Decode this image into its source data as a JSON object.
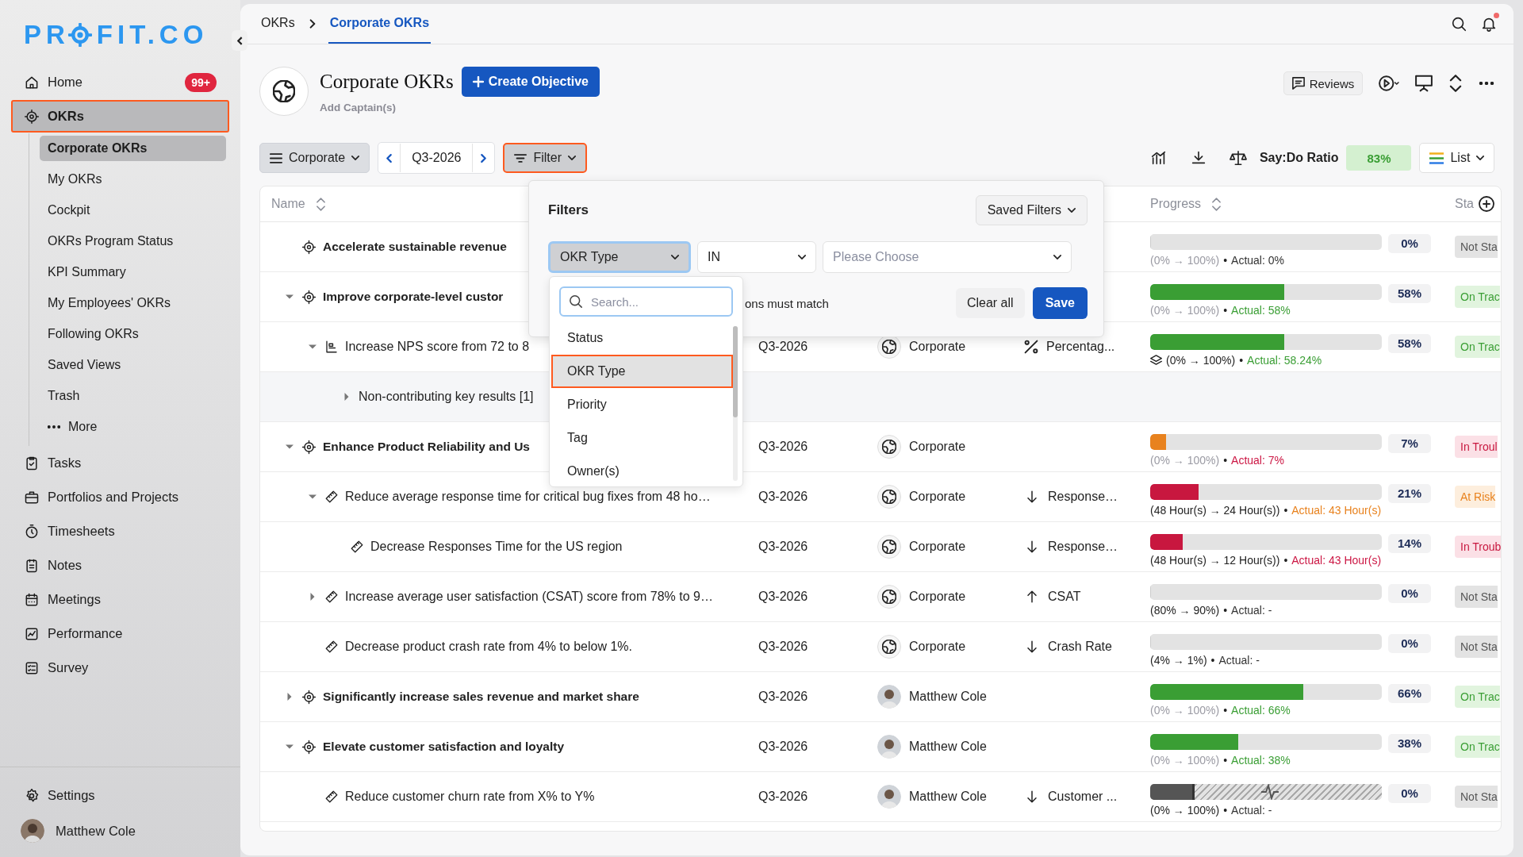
{
  "sidebar": {
    "logo": {
      "before": "PR",
      "after": "FIT.CO"
    },
    "items": [
      {
        "label": "Home",
        "badge": "99+",
        "selected": false,
        "highlighted": false
      },
      {
        "label": "OKRs",
        "selected": true,
        "highlighted": true,
        "expanded": true,
        "children": [
          {
            "label": "Corporate OKRs",
            "selected": true
          },
          {
            "label": "My OKRs",
            "selected": false
          },
          {
            "label": "Cockpit",
            "selected": false
          },
          {
            "label": "OKRs Program Status",
            "selected": false
          },
          {
            "label": "KPI Summary",
            "selected": false
          },
          {
            "label": "My Employees' OKRs",
            "selected": false
          },
          {
            "label": "Following OKRs",
            "selected": false
          },
          {
            "label": "Saved Views",
            "selected": false
          },
          {
            "label": "Trash",
            "selected": false
          },
          {
            "label": "More",
            "selected": false,
            "kind": "more"
          }
        ]
      },
      {
        "label": "Tasks",
        "selected": false,
        "highlighted": false
      },
      {
        "label": "Portfolios and Projects",
        "selected": false,
        "highlighted": false
      },
      {
        "label": "Timesheets",
        "selected": false,
        "highlighted": false
      },
      {
        "label": "Notes",
        "selected": false,
        "highlighted": false
      },
      {
        "label": "Meetings",
        "selected": false,
        "highlighted": false
      },
      {
        "label": "Performance",
        "selected": false,
        "highlighted": false
      },
      {
        "label": "Survey",
        "selected": false,
        "highlighted": false
      }
    ],
    "settings": "Settings",
    "user": "Matthew Cole"
  },
  "breadcrumb": [
    {
      "label": "OKRs",
      "selected": false
    },
    {
      "label": "Corporate OKRs",
      "selected": true
    }
  ],
  "header": {
    "title": "Corporate OKRs",
    "create_button": "Create Objective",
    "captains_link": "Add Captain(s)",
    "reviews_button": "Reviews"
  },
  "toolbar": {
    "view": "Corporate",
    "period": "Q3-2026",
    "filter_button": {
      "label": "Filter",
      "highlighted": true
    },
    "say_do_label": "Say:Do Ratio",
    "say_do_value": "83%",
    "layout": "List"
  },
  "table": {
    "columns": [
      {
        "label": "Name"
      },
      {
        "label": "Progress"
      },
      {
        "label": "Sta"
      }
    ],
    "rows": [
      {
        "kind": "objective",
        "name": "Accelerate sustainable revenue",
        "progress": {
          "kind": "plain",
          "level": 0,
          "percent": "0%",
          "range": "(0% → 100%)",
          "bullet": "•",
          "actual": "Actual: 0%"
        },
        "status": {
          "kind": "not_started",
          "label": "Not Sta"
        }
      },
      {
        "kind": "objective",
        "name": "Improve corporate-level custor",
        "expanded": true,
        "progress": {
          "kind": "plain",
          "level": 0.58,
          "color": "#3a9e34",
          "percent": "58%",
          "range": "(0% → 100%)",
          "bullet": "•",
          "actual": "Actual: 58%"
        },
        "status": {
          "kind": "on_track",
          "label": "On Trac"
        },
        "children": [
          {
            "kind": "kpi",
            "name": "Increase NPS score from 72 to 8",
            "expanded": true,
            "period": "Q3-2026",
            "owner": {
              "kind": "team",
              "name": "Corporate"
            },
            "metric": {
              "kind": "percent",
              "label": "Percentag..."
            },
            "progress": {
              "kind": "plain",
              "level": 0.58,
              "color": "#3a9e34",
              "percent": "58%",
              "range": "(0% → 100%)",
              "bullet": "•",
              "actual": "Actual: 58.24%"
            },
            "status": {
              "kind": "on_track",
              "label": "On Trac"
            },
            "children": [
              {
                "kind": "group",
                "name": "Non-contributing key results [1]",
                "expanded": false
              }
            ]
          }
        ]
      },
      {
        "kind": "objective",
        "name": "Enhance Product Reliability and Us",
        "expanded": true,
        "period": "Q3-2026",
        "owner": {
          "kind": "team",
          "name": "Corporate"
        },
        "progress": {
          "kind": "plain",
          "level": 0.07,
          "color": "#e8821e",
          "percent": "7%",
          "range": "(0% → 100%)",
          "bullet": "•",
          "actual": "Actual: 7%"
        },
        "status": {
          "kind": "in_trouble",
          "label": "In Troul"
        },
        "children": [
          {
            "kind": "key_result",
            "name": "Reduce average response time for critical bug fixes from 48 ho…",
            "expanded": true,
            "period": "Q3-2026",
            "owner": {
              "kind": "team",
              "name": "Corporate"
            },
            "metric": {
              "kind": "down",
              "label": "Response…"
            },
            "progress": {
              "kind": "plain",
              "level": 0.21,
              "color": "#c8173f",
              "percent": "21%",
              "range": "(48 Hour(s) → 24 Hour(s))",
              "bullet": "•",
              "actual": "Actual: 43 Hour(s)"
            },
            "status": {
              "kind": "at_risk",
              "label": "At Risk"
            },
            "children": [
              {
                "kind": "key_result",
                "name": "Decrease Responses Time for the US region",
                "period": "Q3-2026",
                "owner": {
                  "kind": "team",
                  "name": "Corporate"
                },
                "metric": {
                  "kind": "down",
                  "label": "Response…"
                },
                "progress": {
                  "kind": "plain",
                  "level": 0.14,
                  "color": "#c8173f",
                  "percent": "14%",
                  "range": "(48 Hour(s) → 12 Hour(s))",
                  "bullet": "•",
                  "actual": "Actual: 43 Hour(s)"
                },
                "status": {
                  "kind": "in_trouble",
                  "label": "In Troub"
                }
              }
            ]
          },
          {
            "kind": "key_result",
            "name": "Increase average user satisfaction (CSAT) score from 78% to 9…",
            "expanded": false,
            "period": "Q3-2026",
            "owner": {
              "kind": "team",
              "name": "Corporate"
            },
            "metric": {
              "kind": "up",
              "label": "CSAT"
            },
            "progress": {
              "kind": "plain",
              "level": 0,
              "percent": "0%",
              "range": "(80% → 90%)",
              "bullet": "•",
              "actual": "Actual: -"
            },
            "status": {
              "kind": "not_started",
              "label": "Not Sta"
            }
          },
          {
            "kind": "key_result",
            "name": "Decrease product crash rate from 4% to below 1%.",
            "period": "Q3-2026",
            "owner": {
              "kind": "team",
              "name": "Corporate"
            },
            "metric": {
              "kind": "down",
              "label": "Crash Rate"
            },
            "progress": {
              "kind": "plain",
              "level": 0,
              "percent": "0%",
              "range": "(4% → 1%)",
              "bullet": "•",
              "actual": "Actual: -"
            },
            "status": {
              "kind": "not_started",
              "label": "Not Sta"
            }
          }
        ]
      },
      {
        "kind": "objective",
        "name": "Significantly increase sales revenue and market share",
        "expanded": false,
        "period": "Q3-2026",
        "owner": {
          "kind": "person",
          "name": "Matthew Cole"
        },
        "progress": {
          "kind": "plain",
          "level": 0.66,
          "color": "#3a9e34",
          "percent": "66%",
          "range": "(0% → 100%)",
          "bullet": "•",
          "actual": "Actual: 66%"
        },
        "status": {
          "kind": "on_track",
          "label": "On Trac"
        }
      },
      {
        "kind": "objective",
        "name": "Elevate customer satisfaction and loyalty",
        "expanded": true,
        "period": "Q3-2026",
        "owner": {
          "kind": "person",
          "name": "Matthew Cole"
        },
        "progress": {
          "kind": "plain",
          "level": 0.38,
          "color": "#3a9e34",
          "percent": "38%",
          "range": "(0% → 100%)",
          "bullet": "•",
          "actual": "Actual: 38%"
        },
        "status": {
          "kind": "on_track",
          "label": "On Trac"
        },
        "children": [
          {
            "kind": "key_result",
            "name": "Reduce customer churn rate from X% to Y%",
            "period": "Q3-2026",
            "owner": {
              "kind": "person",
              "name": "Matthew Cole"
            },
            "metric": {
              "kind": "down",
              "label": "Customer ..."
            },
            "progress": {
              "kind": "hatched",
              "level": 0.18,
              "color": "#555555",
              "percent": "0%",
              "range": "(0% → 100%)",
              "bullet": "•",
              "actual": "Actual: -"
            },
            "status": {
              "kind": "not_started",
              "label": "Not Sta"
            }
          }
        ]
      }
    ]
  },
  "filter_panel": {
    "title": "Filters",
    "saved_filters": "Saved Filters",
    "field": "OKR Type",
    "operator": "IN",
    "value_placeholder": "Please Choose",
    "match_text": "ons must match",
    "clear_button": "Clear all",
    "save_button": "Save",
    "dropdown": {
      "search_placeholder": "Search...",
      "options": [
        {
          "label": "Status",
          "selected": false,
          "highlighted": false
        },
        {
          "label": "OKR Type",
          "selected": true,
          "highlighted": true
        },
        {
          "label": "Priority",
          "selected": false,
          "highlighted": false
        },
        {
          "label": "Tag",
          "selected": false,
          "highlighted": false
        },
        {
          "label": "Owner(s)",
          "selected": false,
          "highlighted": false
        }
      ]
    }
  }
}
